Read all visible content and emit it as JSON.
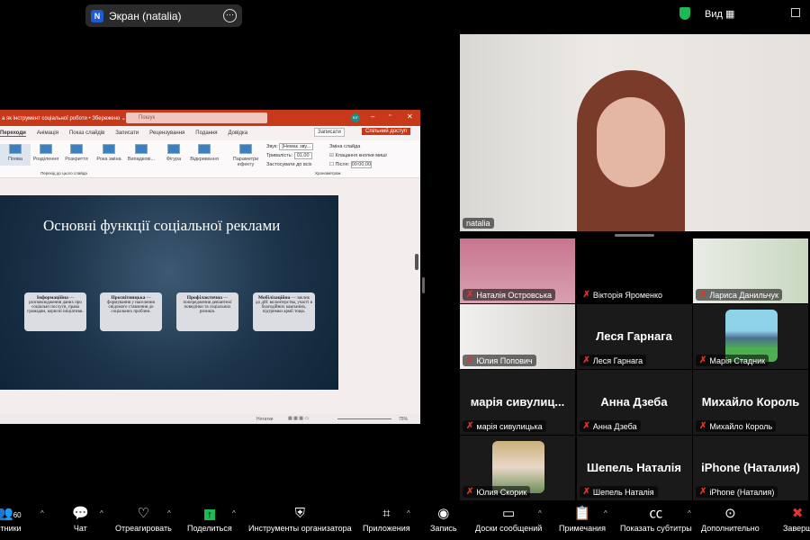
{
  "top": {
    "share_label": "Экран (natalia)",
    "app_letter": "N",
    "view_label": "Вид"
  },
  "ppt": {
    "title": "а як інструмент соціальної роботи • Збережено ⌄",
    "search": "Пошук",
    "avatar": "ЮГ",
    "tabs": [
      "Переходи",
      "Анімація",
      "Показ слайдів",
      "Записати",
      "Рецензування",
      "Подання",
      "Довідка"
    ],
    "record": "Записати",
    "share": "Спільний доступ",
    "transitions": [
      "Поява",
      "Розділення",
      "Розкриття",
      "Рока зміна",
      "Випадкові...",
      "Фігура",
      "Відкривання"
    ],
    "effect_params": "Параметри ефекту",
    "group1": "Перехід до цього слайда",
    "sound_label": "Звук:",
    "sound_value": "[Немає зву...",
    "duration_label": "Тривалість:",
    "duration_value": "01,00",
    "apply_all": "Застосувати до всіх",
    "advance_label": "Зміна слайда",
    "on_click": "Клацання кнопки миші",
    "after_label": "Після:",
    "after_value": "00:00,00",
    "group2": "Хронометраж",
    "notes": "Нотатки",
    "zoom": "75%"
  },
  "slide": {
    "title": "Основні функції соціальної реклами",
    "cards": [
      {
        "head": "Інформаційна",
        "text": " — розповсюдження даних про соціальні послуги, права громадян, корисні ініціативи."
      },
      {
        "head": "Просвітницька",
        "text": " — формування у населення свідомого ставлення до соціальних проблем."
      },
      {
        "head": "Профілактична",
        "text": " — попередження девіантної поведінки та соціальних ризиків."
      },
      {
        "head": "Мобілізаційна",
        "text": " — заклик до дій: волонтерства, участі в благодійних кампаніях, підтримки армії тощо."
      }
    ]
  },
  "main_speaker": "natalia",
  "participants": [
    {
      "name": "Наталія Островська",
      "big": ""
    },
    {
      "name": "Вікторія Яроменко",
      "big": ""
    },
    {
      "name": "Лариса Данильчук",
      "big": ""
    },
    {
      "name": "Юлия Попович",
      "big": ""
    },
    {
      "name": "Леся Гарнага",
      "big": "Леся Гарнага"
    },
    {
      "name": "Марія Стадник",
      "big": ""
    },
    {
      "name": "марія сивулицька",
      "big": "марія  сивулиц..."
    },
    {
      "name": "Анна Дзеба",
      "big": "Анна Дзеба"
    },
    {
      "name": "Михайло Король",
      "big": "Михайло Король"
    },
    {
      "name": "Юлия Скорик",
      "big": ""
    },
    {
      "name": "Шепель Наталія",
      "big": "Шепель Наталія"
    },
    {
      "name": "iPhone (Наталия)",
      "big": "iPhone (Наталия)"
    }
  ],
  "toolbar": {
    "participants": "стники",
    "participants_count": "60",
    "chat": "Чат",
    "react": "Отреагировать",
    "share": "Поделиться",
    "host_tools": "Инструменты организатора",
    "apps": "Приложения",
    "record": "Запись",
    "whiteboards": "Доски сообщений",
    "notes": "Примечания",
    "captions": "Показать субтитры",
    "more": "Дополнительно",
    "end": "Заверш"
  }
}
